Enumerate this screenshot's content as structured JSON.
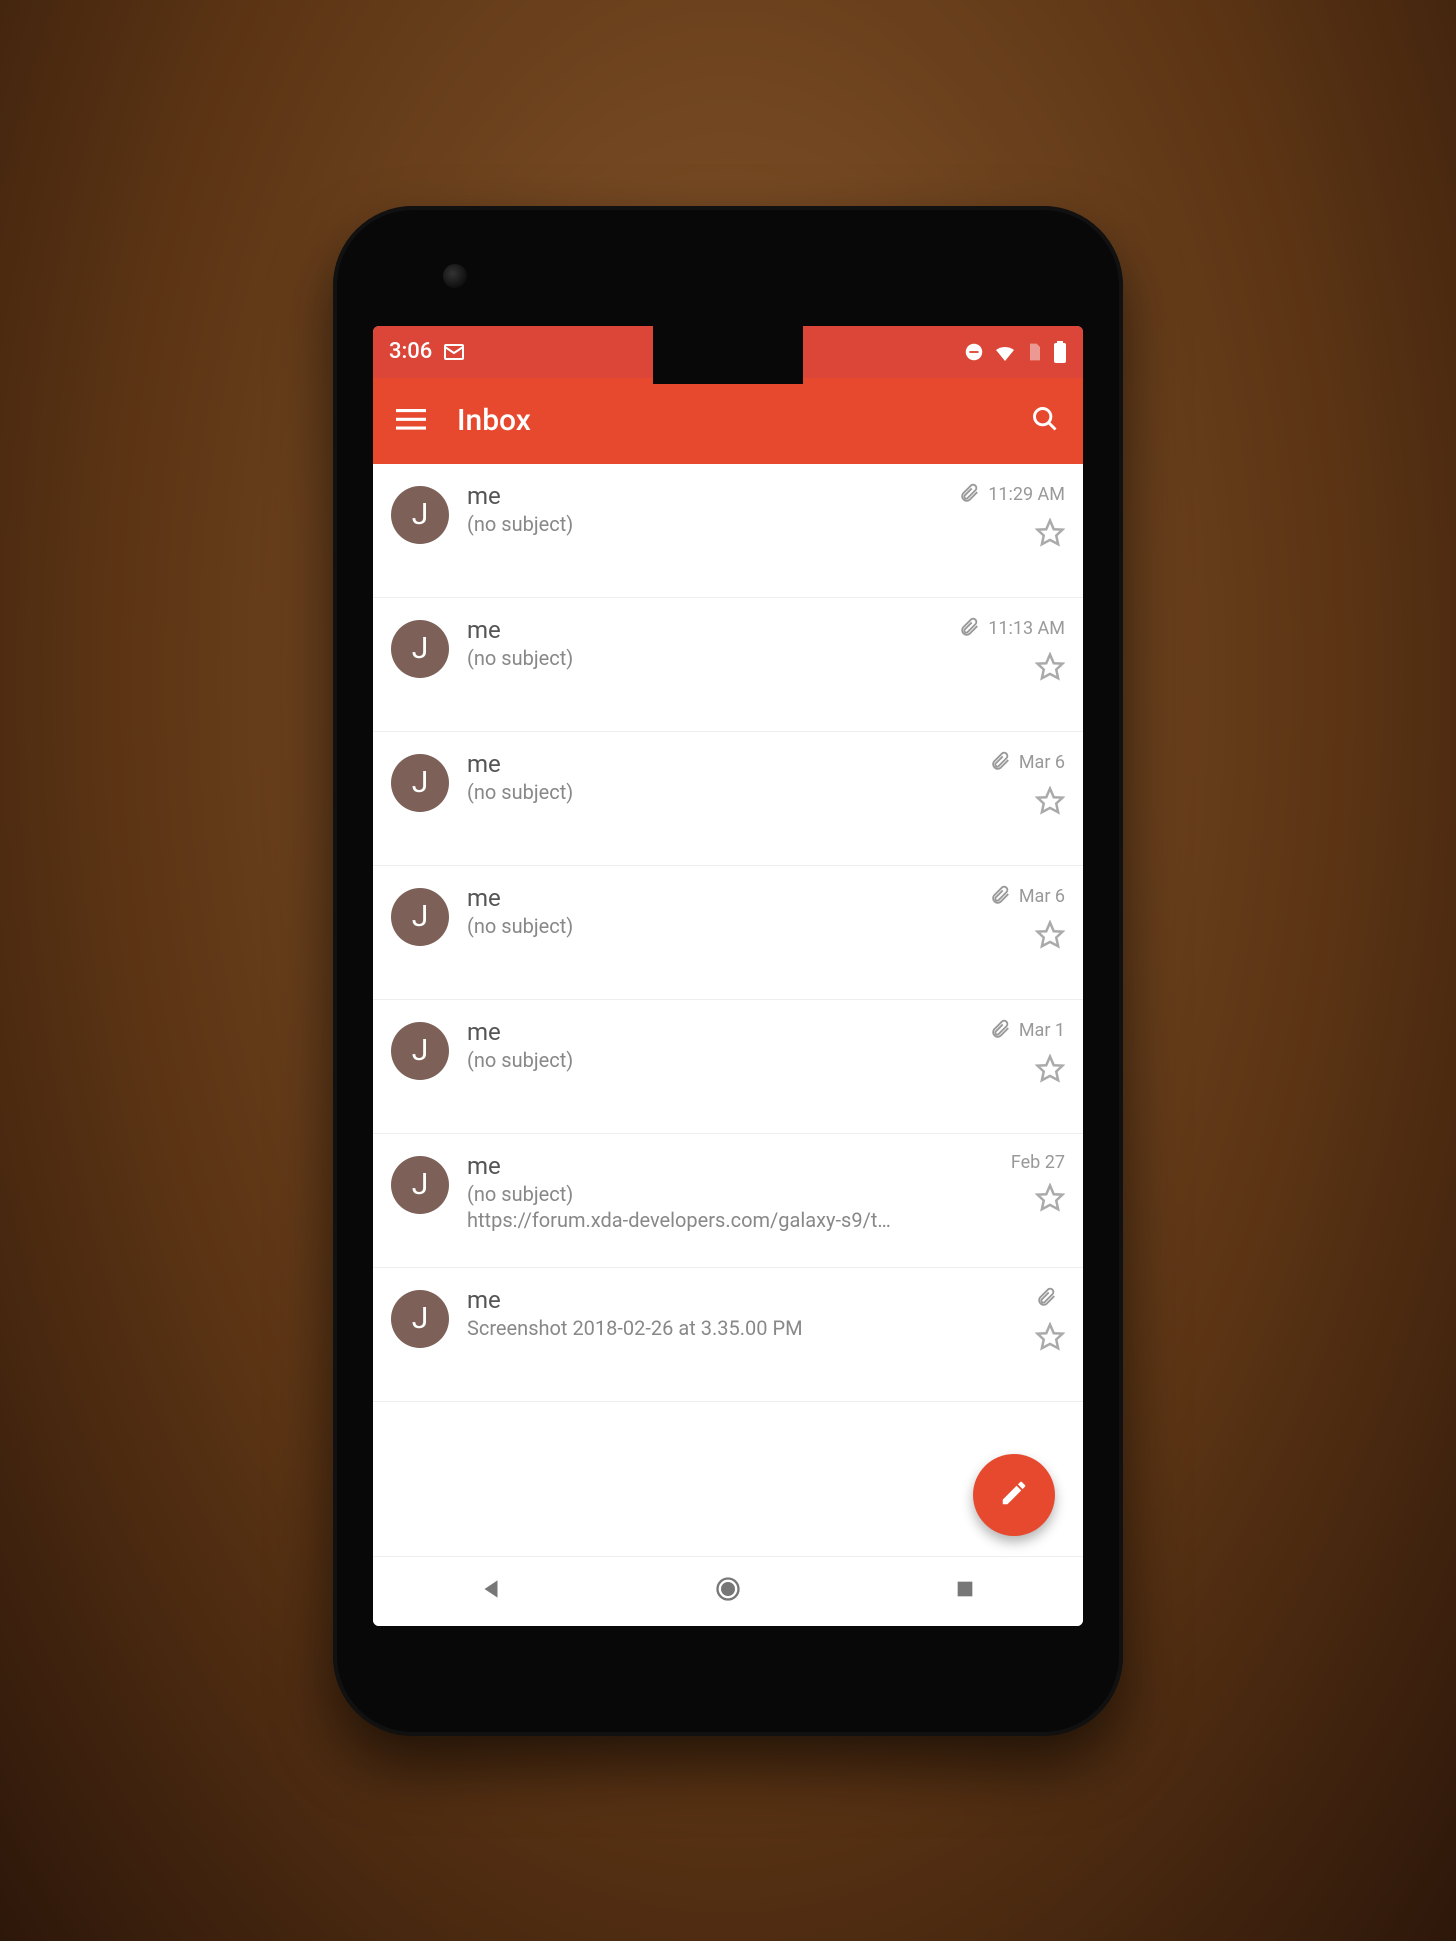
{
  "status": {
    "time": "3:06",
    "mail_icon": "gmail-status-icon",
    "right_icons": [
      "do-not-disturb-icon",
      "wifi-icon",
      "no-sim-icon",
      "battery-icon"
    ]
  },
  "app_bar": {
    "title": "Inbox"
  },
  "avatar_initial": "J",
  "emails": [
    {
      "sender": "me",
      "subject": "(no subject)",
      "snippet": "",
      "time": "11:29 AM",
      "has_attachment": true
    },
    {
      "sender": "me",
      "subject": "(no subject)",
      "snippet": "",
      "time": "11:13 AM",
      "has_attachment": true
    },
    {
      "sender": "me",
      "subject": "(no subject)",
      "snippet": "",
      "time": "Mar 6",
      "has_attachment": true
    },
    {
      "sender": "me",
      "subject": "(no subject)",
      "snippet": "",
      "time": "Mar 6",
      "has_attachment": true
    },
    {
      "sender": "me",
      "subject": "(no subject)",
      "snippet": "",
      "time": "Mar 1",
      "has_attachment": true
    },
    {
      "sender": "me",
      "subject": "(no subject)",
      "snippet": "https://forum.xda-developers.com/galaxy-s9/t…",
      "time": "Feb 27",
      "has_attachment": false
    },
    {
      "sender": "me",
      "subject": "Screenshot 2018-02-26 at 3.35.00 PM",
      "snippet": "",
      "time": "",
      "has_attachment": true
    }
  ],
  "colors": {
    "status_bar": "#db4638",
    "app_bar": "#e6492e",
    "fab": "#e6492e",
    "avatar": "#7d6158"
  }
}
